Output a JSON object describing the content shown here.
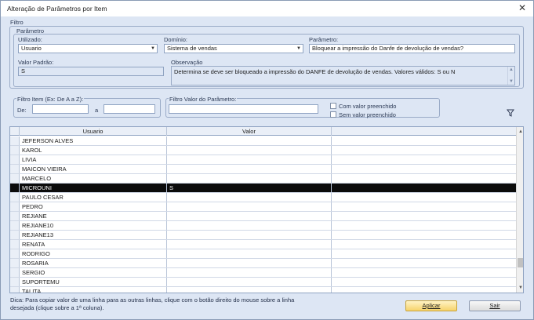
{
  "window": {
    "title": "Alteração de Parâmetros por Item",
    "close_glyph": "✕"
  },
  "filtro": {
    "group_label": "Filtro",
    "parametro_group_label": "Parâmetro",
    "utilizado": {
      "label": "Utilizado:",
      "value": "Usuario"
    },
    "dominio": {
      "label": "Domínio:",
      "value": "Sistema de vendas"
    },
    "parametro": {
      "label": "Parâmetro:",
      "value": "Bloquear a impressão do Danfe de devolução de vendas?"
    },
    "valor_padrao": {
      "label": "Valor Padrão:",
      "value": "S"
    },
    "observacao": {
      "label": "Observação",
      "value": "Determina se deve ser bloqueado a impressão do DANFE de devolução de vendas. Valores válidos: S ou N"
    }
  },
  "filtro_item": {
    "label": "Filtro Item (Ex: De A a Z):",
    "de_label": "De:",
    "a_label": "a",
    "de_value": "",
    "a_value": ""
  },
  "filtro_valor": {
    "label": "Filtro Valor do Parâmetro:",
    "value": "",
    "com_valor_label": "Com valor preenchido",
    "sem_valor_label": "Sem valor preenchido"
  },
  "icons": {
    "filter": "filter-icon",
    "dropdown": "chevron-down-icon"
  },
  "grid": {
    "columns": [
      "Usuario",
      "Valor",
      ""
    ],
    "rows": [
      {
        "usuario": "JEFERSON ALVES",
        "valor": ""
      },
      {
        "usuario": "KAROL",
        "valor": ""
      },
      {
        "usuario": "LIVIA",
        "valor": ""
      },
      {
        "usuario": "MAICON VIEIRA",
        "valor": ""
      },
      {
        "usuario": "MARCELO",
        "valor": ""
      },
      {
        "usuario": "MICROUNI",
        "valor": "S"
      },
      {
        "usuario": "PAULO CESAR",
        "valor": ""
      },
      {
        "usuario": "PEDRO",
        "valor": ""
      },
      {
        "usuario": "REJIANE",
        "valor": ""
      },
      {
        "usuario": "REJIANE10",
        "valor": ""
      },
      {
        "usuario": "REJIANE13",
        "valor": ""
      },
      {
        "usuario": "RENATA",
        "valor": ""
      },
      {
        "usuario": "RODRIGO",
        "valor": ""
      },
      {
        "usuario": "ROSARIA",
        "valor": ""
      },
      {
        "usuario": "SERGIO",
        "valor": ""
      },
      {
        "usuario": "SUPORTEMU",
        "valor": ""
      },
      {
        "usuario": "TALITA",
        "valor": ""
      }
    ],
    "selected_index": 5
  },
  "footer": {
    "hint": "Dica: Para copiar valor de uma linha para as outras linhas, clique com o botão direito do mouse sobre a linha desejada (clique sobre a 1ª coluna).",
    "aplicar_label": "Aplicar",
    "sair_label": "Sair"
  },
  "colors": {
    "selected_row": "#0b0b0b",
    "window_bg": "#dde6f4",
    "primary_button": "#f6d36b"
  }
}
